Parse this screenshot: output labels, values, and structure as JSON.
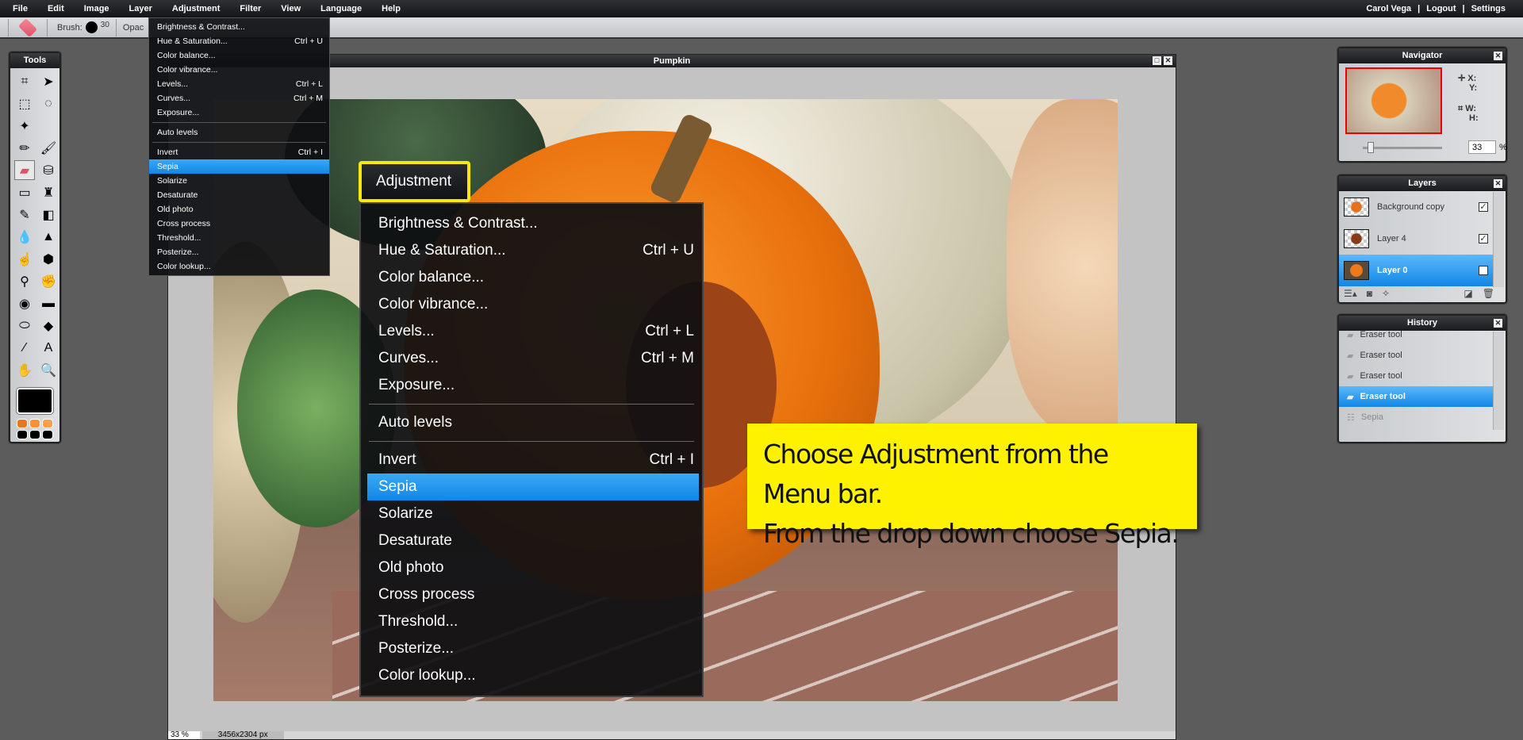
{
  "menubar": {
    "items": [
      "File",
      "Edit",
      "Image",
      "Layer",
      "Adjustment",
      "Filter",
      "View",
      "Language",
      "Help"
    ],
    "user": "Carol Vega",
    "logout": "Logout",
    "settings": "Settings",
    "divider": "|"
  },
  "toolbar": {
    "brush_label": "Brush:",
    "brush_size": "30",
    "opacity_label": "Opac"
  },
  "tools": {
    "title": "Tools",
    "items": [
      "crop-icon",
      "move-icon",
      "marquee-icon",
      "lasso-icon",
      "magic-wand-icon",
      "",
      "pencil-icon",
      "brush-icon",
      "eraser-icon",
      "bucket-icon",
      "gradient-icon",
      "clone-stamp-icon",
      "color-replace-icon",
      "shape-icon",
      "blur-icon",
      "sharpen-icon",
      "smudge-icon",
      "sponge-icon",
      "dodge-icon",
      "burn-icon",
      "red-eye-icon",
      "spot-heal-icon",
      "bloat-icon",
      "pinch-icon",
      "color-picker-icon",
      "type-icon",
      "hand-icon",
      "zoom-icon"
    ],
    "fg_color": "#000000",
    "swatches": [
      "#e87722",
      "#f7923a",
      "#f9a04a",
      "#000000",
      "#000000",
      "#000000"
    ]
  },
  "document": {
    "title": "Pumpkin",
    "zoom": "33",
    "zoom_unit": "%",
    "size": "3456x2304 px"
  },
  "adjustment_menu": {
    "title": "Adjustment",
    "items": [
      {
        "label": "Brightness & Contrast...",
        "shortcut": ""
      },
      {
        "label": "Hue & Saturation...",
        "shortcut": "Ctrl + U"
      },
      {
        "label": "Color balance...",
        "shortcut": ""
      },
      {
        "label": "Color vibrance...",
        "shortcut": ""
      },
      {
        "label": "Levels...",
        "shortcut": "Ctrl + L"
      },
      {
        "label": "Curves...",
        "shortcut": "Ctrl + M"
      },
      {
        "label": "Exposure...",
        "shortcut": ""
      },
      {
        "sep": true
      },
      {
        "label": "Auto levels",
        "shortcut": ""
      },
      {
        "sep": true
      },
      {
        "label": "Invert",
        "shortcut": "Ctrl + I"
      },
      {
        "label": "Sepia",
        "shortcut": "",
        "highlighted": true
      },
      {
        "label": "Solarize",
        "shortcut": ""
      },
      {
        "label": "Desaturate",
        "shortcut": ""
      },
      {
        "label": "Old photo",
        "shortcut": ""
      },
      {
        "label": "Cross process",
        "shortcut": ""
      },
      {
        "label": "Threshold...",
        "shortcut": ""
      },
      {
        "label": "Posterize...",
        "shortcut": ""
      },
      {
        "label": "Color lookup...",
        "shortcut": ""
      }
    ]
  },
  "callout": {
    "line1": "Choose Adjustment from the Menu bar.",
    "line2": "From the drop down choose Sepia.",
    "color": "#fff200"
  },
  "navigator": {
    "title": "Navigator",
    "x": "X:",
    "y": "Y:",
    "w": "W:",
    "h": "H:",
    "zoom": "33",
    "unit": "%",
    "zoom_fraction": 0.1
  },
  "layers": {
    "title": "Layers",
    "items": [
      {
        "name": "Background copy",
        "visible": true
      },
      {
        "name": "Layer 4",
        "visible": true
      },
      {
        "name": "Layer 0",
        "visible": true,
        "selected": true
      }
    ]
  },
  "history": {
    "title": "History",
    "items": [
      {
        "name": "Eraser tool"
      },
      {
        "name": "Eraser tool"
      },
      {
        "name": "Eraser tool"
      },
      {
        "name": "Eraser tool",
        "selected": true
      },
      {
        "name": "Sepia",
        "dimmed": true
      }
    ]
  },
  "accent": "#1187e6"
}
